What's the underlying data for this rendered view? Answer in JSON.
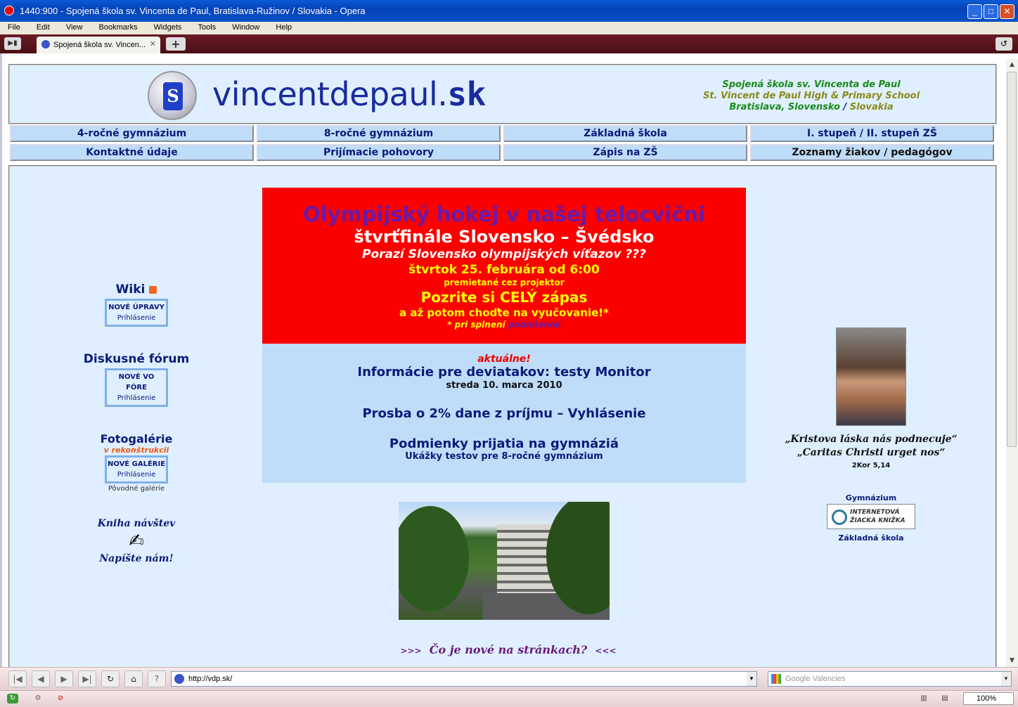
{
  "window": {
    "title": "1440:900 - Spojená škola sv. Vincenta de Paul, Bratislava-Ružinov / Slovakia - Opera"
  },
  "menu": [
    "File",
    "Edit",
    "View",
    "Bookmarks",
    "Widgets",
    "Tools",
    "Window",
    "Help"
  ],
  "tab": {
    "title": "Spojená škola sv. Vincen...",
    "close": "✕"
  },
  "toolbar": {
    "new_tab": "+"
  },
  "site": {
    "logo_mark": "S",
    "name_main": "vincentdepaul.",
    "name_tld": "sk",
    "school_sk": "Spojená škola sv. Vincenta de Paul",
    "school_en": "St. Vincent de Paul High & Primary School",
    "location_1": "Bratislava, Slovensko",
    "location_sep": "/",
    "location_2": "Slovakia"
  },
  "nav": {
    "row1": [
      "4-ročné gymnázium",
      "8-ročné gymnázium",
      "Základná škola",
      "I. stupeň / II. stupeň ZŠ"
    ],
    "row2": [
      "Kontaktné údaje",
      "Prijímacie pohovory",
      "Zápis na ZŠ",
      "Zoznamy žiakov / pedagógov"
    ]
  },
  "sidebar": {
    "wiki_label": "Wiki",
    "wiki_btn_1": "NOVÉ ÚPRAVY",
    "wiki_btn_2": "Prihlásenie",
    "forum_label": "Diskusné fórum",
    "forum_btn_1": "NOVÉ VO FÓRE",
    "forum_btn_2": "Prihlásenie",
    "gallery_label": "Fotogalérie",
    "gallery_note": "v rekonštrukcii",
    "gallery_btn_1": "NOVÉ GALÉRIE",
    "gallery_btn_2": "Prihlásenie",
    "gallery_old": "Pôvodné galérie",
    "guestbook_label": "Kniha návštev",
    "guestbook_cta": "Napíšte nám!"
  },
  "banner": {
    "line1": "Olympijský hokej v našej telocvični",
    "line2": "štvrťfinále Slovensko – Švédsko",
    "line3": "Porazí Slovensko olympijských víťazov ???",
    "line4": "štvrtok 25. februára od 6:00",
    "line5": "premietané cez projektor",
    "line6": "Pozrite si CELÝ zápas",
    "line7": "a až potom choďte na vyučovanie!*",
    "line8": "* pri splnení",
    "line8_link": "podmienok"
  },
  "news": {
    "tag": "aktuálne!",
    "item1_title": "Informácie pre deviatakov: testy Monitor",
    "item1_date": "streda 10. marca 2010",
    "item2_title": "Prosba o 2% dane z príjmu – Vyhlásenie",
    "item3_title": "Podmienky prijatia na gymnáziá",
    "item3_sub": "Ukážky testov pre 8-ročné gymnázium"
  },
  "whatsnew": {
    "left": ">>>",
    "text": "Čo je nové na stránkach?",
    "right": "<<<"
  },
  "right": {
    "quote1": "„Kristova láska nás podnecuje“",
    "quote2": "„Caritas Christi urget nos“",
    "ref": "2Kor 5,14",
    "gym_label": "Gymnázium",
    "ezk_1": "INTERNETOVÁ",
    "ezk_2": "ŽIACKA KNIŽKA",
    "zs_label": "Základná škola"
  },
  "address_bar": {
    "url": "http://vdp.sk/"
  },
  "search_bar": {
    "placeholder": "Google Valencies"
  },
  "status": {
    "zoom": "100%"
  },
  "colors": {
    "page_bg": "#dfefff",
    "nav_bg": "#bfdcf8",
    "banner_bg": "#fc0000",
    "accent_navy": "#0a1a7a"
  }
}
